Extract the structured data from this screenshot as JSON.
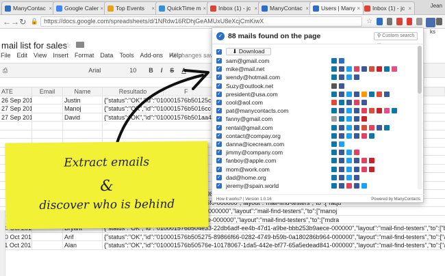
{
  "browser": {
    "tabs": [
      {
        "label": "ManyContac",
        "color": "#2c6fc4",
        "active": false
      },
      {
        "label": "Google Calen",
        "color": "#4285f4",
        "active": false
      },
      {
        "label": "Top Events",
        "color": "#e8a317",
        "active": false
      },
      {
        "label": "QuickTime m",
        "color": "#3b8fd6",
        "active": false
      },
      {
        "label": "Inbox (1) - jc",
        "color": "#db4437",
        "active": false
      },
      {
        "label": "ManyContac",
        "color": "#2c6fc4",
        "active": false
      },
      {
        "label": "Users | Many",
        "color": "#2c6fc4",
        "active": true
      },
      {
        "label": "Inbox (1) - jc",
        "color": "#db4437",
        "active": false
      }
    ],
    "profile": "Jean",
    "url": "https://docs.google.com/spreadsheets/d/1NRdw16RDhjGeAMUxU8eXcjCmKiwX"
  },
  "sheet": {
    "title": "mail list for sales",
    "menu": [
      "File",
      "Edit",
      "View",
      "Insert",
      "Format",
      "Data",
      "Tools",
      "Add-ons",
      "Help"
    ],
    "saved_status": "All changes saved",
    "font": "Arial",
    "font_size": "10",
    "format_buttons": [
      "B",
      "I",
      "S",
      "A"
    ],
    "column_headers": [
      "ATE",
      "Email",
      "Name",
      "Resultado",
      "F"
    ],
    "rows": [
      [
        "26 Sep 2016",
        "",
        "Justin",
        "{\"status\":\"OK\",\"id\":\"010001576b50125c-0"
      ],
      [
        "27 Sep 2016",
        "",
        "Manoj",
        "{\"status\":\"OK\",\"id\":\"010001576b5016cc-9"
      ],
      [
        "27 Sep 2016",
        "",
        "David",
        "{\"status\":\"OK\",\"id\":\"010001576b501aa4-9"
      ],
      [
        "",
        "",
        "",
        ""
      ],
      [
        "",
        "",
        "",
        ""
      ],
      [
        "",
        "",
        "",
        ""
      ],
      [
        "",
        "",
        "",
        ""
      ],
      [
        "",
        "",
        "",
        ""
      ],
      [
        "",
        "",
        "",
        ""
      ],
      [
        "",
        "",
        "",
        ""
      ],
      [
        "",
        "",
        "",
        ""
      ],
      [
        "",
        "",
        "",
        "698859-1b9fd-45a7-9e32-7dae00783985-000000\",\"layout\":\"mail-find-testers\",\"to\":[\"arq"
      ],
      [
        "",
        "",
        "",
        "a62a1f5-a48b-4306-a644-2a5edcd225f0-000000\",\"layout\":\"mail-find-testers\",\"to\":[\"raqu"
      ],
      [
        "",
        "",
        "",
        "0ed86-7f77-47eb-ac0e-5f51602f3155-000000\",\"layout\":\"mail-find-testers\",\"to\":[\"manoj"
      ],
      [
        "",
        "",
        "",
        "c5ee8d-4f5e-4a85-abed-0a7041b78cfe-000000\",\"layout\":\"mail-find-testers\",\"to\":[\"mdra"
      ],
      [
        "10 Oct 2016",
        "",
        "Bryant",
        "{\"status\":\"OK\",\"id\":\"010001576b504e33-22db6adf-ee4b-47d1-a9be-bbb253b9aece-000000\",\"layout\":\"mail-find-testers\",\"to\":[\"bryan"
      ],
      [
        "10 Oct 2016",
        "",
        "Arif",
        "{\"status\":\"OK\",\"id\":\"010001576b505275-89866f66-0282-4749-b59b-0a180286b964-000000\",\"layout\":\"mail-find-testers\",\"to\":[\"arifw"
      ],
      [
        "11 Oct 2016",
        "",
        "Alan",
        "{\"status\":\"OK\",\"id\":\"010001576b50576e-10178067-1da5-442e-bf77-65a5edead841-000000\",\"layout\":\"mail-find-testers\",\"to\":[\"alan"
      ]
    ]
  },
  "sticky_note": {
    "line1": "Extract emails",
    "line2": "&",
    "line3": "discover who is behind"
  },
  "popup": {
    "title": "88 mails found on the page",
    "search_placeholder": "Custom search ...",
    "download_label": "Download",
    "emails": [
      {
        "email": "sam@gmail.com",
        "icons": [
          "#0e76a8",
          "#2c6fc4"
        ]
      },
      {
        "email": "mike@mail.net",
        "icons": [
          "#0e76a8",
          "#3b5998",
          "#1da1f2",
          "#e4405f",
          "#3b5998",
          "#dd4b39",
          "#c92228",
          "#0e76a8",
          "#ea4c89"
        ]
      },
      {
        "email": "wendy@hotmail.com",
        "icons": [
          "#0e76a8",
          "#3b5998",
          "#1da1f2",
          "#3b5998"
        ]
      },
      {
        "email": "Suzy@outlook.net",
        "icons": [
          "#555555",
          "#3b5998"
        ]
      },
      {
        "email": "president@usa.com",
        "icons": [
          "#0e76a8",
          "#3b5998",
          "#1da1f2",
          "#3b5998",
          "#ff9900",
          "#0e76a8",
          "#dd4b39",
          "#3b5998"
        ]
      },
      {
        "email": "cool@aol.com",
        "icons": [
          "#dd4b39",
          "#0e76a8",
          "#3b5998",
          "#e4405f",
          "#3b5998"
        ]
      },
      {
        "email": "pat@manycontacts.com",
        "icons": [
          "#0e76a8",
          "#3b5998",
          "#1da1f2",
          "#3b5998",
          "#e4405f",
          "#dd4b39",
          "#c92228",
          "#ea4c89",
          "#0e76a8"
        ]
      },
      {
        "email": "fanny@gmail.com",
        "icons": [
          "#9e9e9e",
          "#0e76a8",
          "#1da1f2",
          "#3b5998",
          "#c92228"
        ]
      },
      {
        "email": "rental@gmail.com",
        "icons": [
          "#0e76a8",
          "#3b5998",
          "#1da1f2",
          "#3b5998",
          "#dd4b39",
          "#e4405f",
          "#3b5998",
          "#0e76a8"
        ]
      },
      {
        "email": "contact@compay.org",
        "icons": [
          "#0e76a8",
          "#3b5998",
          "#1da1f2",
          "#3b5998",
          "#e4405f",
          "#0e76a8"
        ]
      },
      {
        "email": "danna@icecream.com",
        "icons": [
          "#0e76a8",
          "#1da1f2"
        ]
      },
      {
        "email": "jimmy@company.com",
        "icons": [
          "#0e76a8",
          "#3b5998",
          "#1da1f2",
          "#e4405f"
        ]
      },
      {
        "email": "fanboy@apple.com",
        "icons": [
          "#0e76a8",
          "#3b5998",
          "#1da1f2",
          "#3b5998",
          "#e4405f",
          "#c92228"
        ]
      },
      {
        "email": "mom@work.com",
        "icons": [
          "#0e76a8",
          "#3b5998",
          "#1da1f2",
          "#3b5998",
          "#e4405f",
          "#c92228"
        ]
      },
      {
        "email": "dad@home.org",
        "icons": [
          "#0e76a8",
          "#3b5998",
          "#1da1f2",
          "#3b5998"
        ]
      },
      {
        "email": "jeremy@spain.world",
        "icons": [
          "#0e76a8",
          "#3b5998",
          "#e4405f",
          "#3b5998",
          "#1da1f2"
        ]
      }
    ],
    "footer_left": "How it works? | Version 1.0.16",
    "footer_right": "Powered by ManyContacts"
  },
  "side_partial_label": "ks",
  "colors": {
    "accent": "#2c6fc4",
    "sticky": "#f3f136",
    "chrome": "#dcdcdc"
  }
}
